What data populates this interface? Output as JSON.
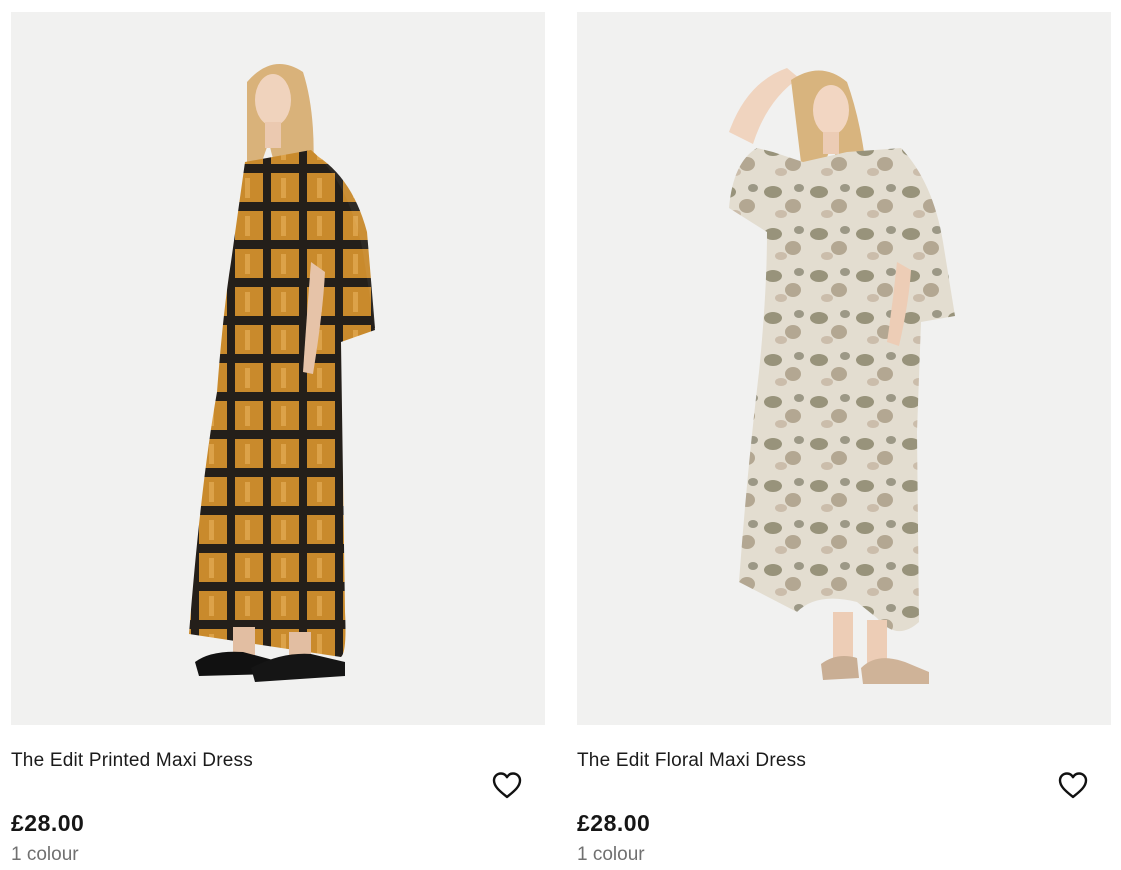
{
  "products": [
    {
      "name": "The Edit Printed Maxi Dress",
      "price": "£28.00",
      "colours": "1 colour",
      "image_alt": "Model wearing black and mustard check print maxi dress"
    },
    {
      "name": "The Edit Floral Maxi Dress",
      "price": "£28.00",
      "colours": "1 colour",
      "image_alt": "Model wearing sage and beige watercolour floral maxi dress"
    }
  ],
  "icons": {
    "wishlist": "heart-outline-icon"
  },
  "colors": {
    "image_bg": "#f1f1f0",
    "text": "#1b1b1b",
    "muted": "#707070"
  }
}
